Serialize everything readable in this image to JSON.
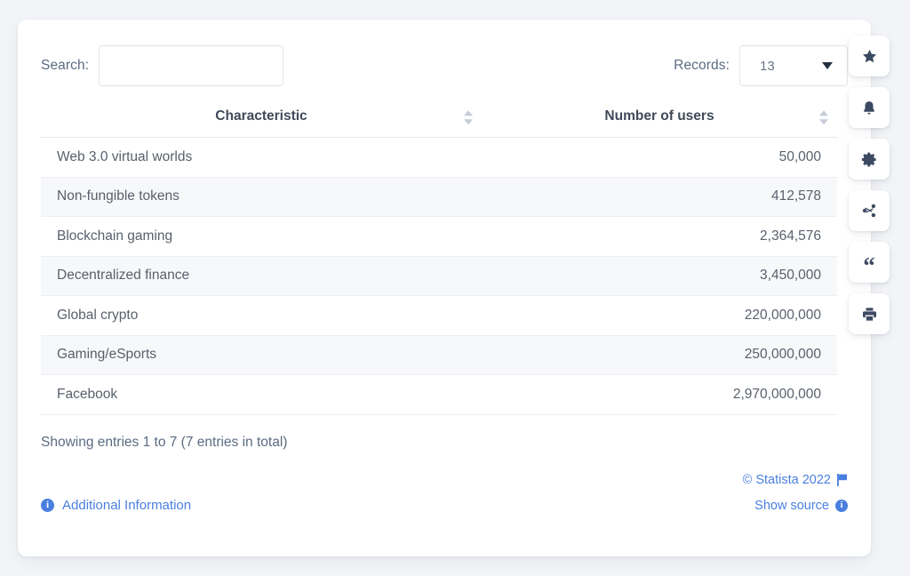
{
  "controls": {
    "search_label": "Search:",
    "search_value": "",
    "search_placeholder": "",
    "records_label": "Records:",
    "records_value": "13"
  },
  "table": {
    "columns": [
      "Characteristic",
      "Number of users"
    ],
    "rows": [
      {
        "characteristic": "Web 3.0 virtual worlds",
        "users": "50,000"
      },
      {
        "characteristic": "Non-fungible tokens",
        "users": "412,578"
      },
      {
        "characteristic": "Blockchain gaming",
        "users": "2,364,576"
      },
      {
        "characteristic": "Decentralized finance",
        "users": "3,450,000"
      },
      {
        "characteristic": "Global crypto",
        "users": "220,000,000"
      },
      {
        "characteristic": "Gaming/eSports",
        "users": "250,000,000"
      },
      {
        "characteristic": "Facebook",
        "users": "2,970,000,000"
      }
    ]
  },
  "footer": {
    "showing": "Showing entries 1 to 7 (7 entries in total)",
    "additional_information": "Additional Information",
    "copyright": "© Statista 2022",
    "show_source": "Show source"
  },
  "rail": {
    "buttons": [
      {
        "name": "favorite",
        "icon": "star-icon"
      },
      {
        "name": "notify",
        "icon": "bell-icon"
      },
      {
        "name": "settings",
        "icon": "gear-icon"
      },
      {
        "name": "share",
        "icon": "share-icon"
      },
      {
        "name": "cite",
        "icon": "quote-icon"
      },
      {
        "name": "print",
        "icon": "print-icon"
      }
    ]
  },
  "colors": {
    "page_background": "#f2f4f7",
    "card_background": "#ffffff",
    "link_blue": "#4a7fe0",
    "row_stripe": "#f7f8fa",
    "text_muted": "#5b6b82"
  }
}
